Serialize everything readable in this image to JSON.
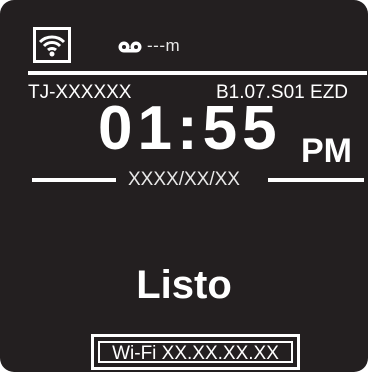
{
  "header": {
    "wifi_icon": "wifi-icon",
    "tape_icon": "tape-icon",
    "tape_remaining": "---m"
  },
  "info": {
    "device_id": "TJ-XXXXXX",
    "firmware": "B1.07.S01 EZD"
  },
  "clock": {
    "time": "01:55",
    "ampm": "PM",
    "date": "XXXX/XX/XX"
  },
  "status": {
    "text": "Listo"
  },
  "network": {
    "wifi_label": "Wi-Fi XX.XX.XX.XX"
  },
  "colors": {
    "background": "#231f20",
    "foreground": "#ffffff"
  }
}
